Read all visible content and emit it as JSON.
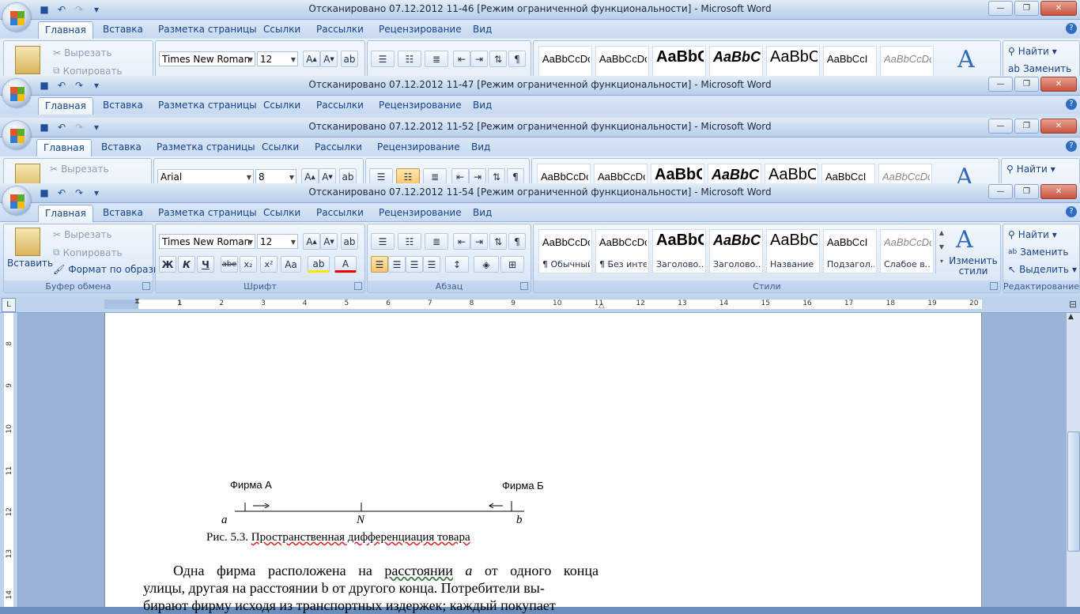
{
  "app": {
    "name": "Microsoft Word",
    "tab_help": "?"
  },
  "windows": [
    {
      "title": "Отсканировано 07.12.2012 11-46 [Режим ограниченной функциональности]  -  Microsoft Word"
    },
    {
      "title": "Отсканировано 07.12.2012 11-47 [Режим ограниченной функциональности]  -  Microsoft Word"
    },
    {
      "title": "Отсканировано 07.12.2012 11-52 [Режим ограниченной функциональности]  -  Microsoft Word"
    },
    {
      "title": "Отсканировано 07.12.2012 11-54 [Режим ограниченной функциональности]  -  Microsoft Word"
    }
  ],
  "tabs": [
    "Главная",
    "Вставка",
    "Разметка страницы",
    "Ссылки",
    "Рассылки",
    "Рецензирование",
    "Вид"
  ],
  "clipboard": {
    "paste": "Вставить",
    "cut": "Вырезать",
    "copy": "Копировать",
    "format_painter": "Формат по образцу",
    "group": "Буфер обмена"
  },
  "font": {
    "family": "Times New Roman",
    "size": "12",
    "family_alt": "Arial",
    "size_alt": "8",
    "group": "Шрифт",
    "bold": "Ж",
    "italic": "К",
    "underline": "Ч",
    "strike": "abe",
    "sub": "x₂",
    "sup": "x²",
    "case": "Aa",
    "grow": "A",
    "shrink": "A"
  },
  "paragraph": {
    "group": "Абзац"
  },
  "styles": {
    "group": "Стили",
    "items": [
      {
        "sample": "AaBbCcDc",
        "name": "¶ Обычный"
      },
      {
        "sample": "AaBbCcDc",
        "name": "¶ Без инте..."
      },
      {
        "sample": "AaBbC",
        "name": "Заголово..."
      },
      {
        "sample": "AaBbCc",
        "name": "Заголово..."
      },
      {
        "sample": "AaBbC",
        "name": "Название"
      },
      {
        "sample": "AaBbCcI",
        "name": "Подзагол..."
      },
      {
        "sample": "AaBbCcDc",
        "name": "Слабое в..."
      }
    ],
    "change": "Изменить стили"
  },
  "editing": {
    "find": "Найти",
    "replace": "Заменить",
    "select": "Выделить",
    "group": "Редактирование"
  },
  "ruler": {
    "h_labels": [
      "1",
      "1",
      "2",
      "3",
      "4",
      "5",
      "6",
      "7",
      "8",
      "9",
      "10",
      "11",
      "12",
      "13",
      "14",
      "15",
      "16",
      "17",
      "18",
      "19",
      "20"
    ],
    "v_labels": [
      "8",
      "9",
      "10",
      "11",
      "12",
      "13",
      "14"
    ]
  },
  "document": {
    "firm_a": "Фирма А",
    "firm_b": "Фирма Б",
    "label_a": "a",
    "label_n": "N",
    "label_b": "b",
    "caption_prefix": "Рис. 5.3. ",
    "caption_main": "Пространственная дифференциация товара",
    "para1_l1a": "Одна фирма расположена на ",
    "para1_l1b": "расстоянии",
    "para1_l1c": " ",
    "para1_l1d": "a",
    "para1_l1e": " от одного конца",
    "para1_l2": "улицы, другая на расстоянии b от другого конца. Потребители вы-",
    "para1_l3": "бирают фирму исходя из транспортных издержек; каждый покупает"
  }
}
